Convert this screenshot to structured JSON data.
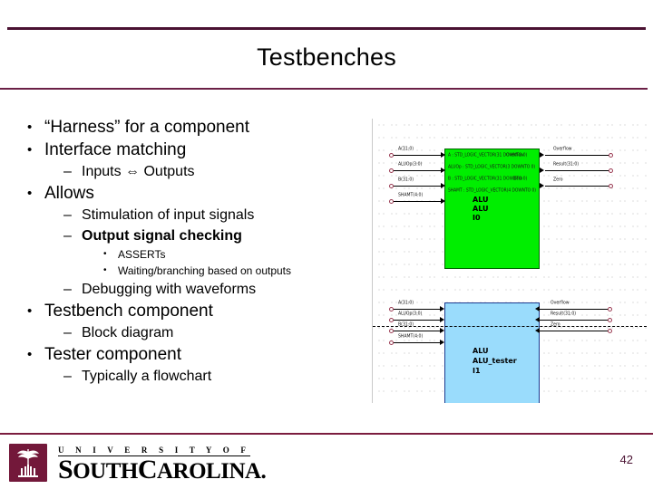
{
  "slide": {
    "title": "Testbenches",
    "page_number": "42",
    "accent_color": "#4a1232",
    "rule_color": "#6b2046"
  },
  "bullets": [
    {
      "level": 1,
      "marker": "•",
      "text": "“Harness” for a component",
      "bold": false
    },
    {
      "level": 1,
      "marker": "•",
      "text": "Interface matching",
      "bold": false
    },
    {
      "level": 2,
      "marker": "–",
      "text": "Inputs ⇔ Outputs",
      "bold": false
    },
    {
      "level": 1,
      "marker": "•",
      "text": "Allows",
      "bold": false
    },
    {
      "level": 2,
      "marker": "–",
      "text": "Stimulation of input signals",
      "bold": false
    },
    {
      "level": 2,
      "marker": "–",
      "text": "Output signal checking",
      "bold": true
    },
    {
      "level": 3,
      "marker": "•",
      "text": "ASSERTs",
      "bold": false
    },
    {
      "level": 3,
      "marker": "•",
      "text": "Waiting/branching based on outputs",
      "bold": false
    },
    {
      "level": 2,
      "marker": "–",
      "text": "Debugging with waveforms",
      "bold": false
    },
    {
      "level": 1,
      "marker": "•",
      "text": "Testbench component",
      "bold": false
    },
    {
      "level": 2,
      "marker": "–",
      "text": "Block diagram",
      "bold": false
    },
    {
      "level": 1,
      "marker": "•",
      "text": "Tester component",
      "bold": false
    },
    {
      "level": 2,
      "marker": "–",
      "text": "Typically a flowchart",
      "bold": false
    }
  ],
  "schematic": {
    "green_block": {
      "fill_color": "#00ee00",
      "label_lines": [
        "ALU",
        "ALU",
        "I0"
      ],
      "port_text_lines": [
        "A : STD_LOGIC_VECTOR(31 DOWNTO 0)",
        "ALUOp : STD_LOGIC_VECTOR(3 DOWNTO 0)",
        "B : STD_LOGIC_VECTOR(31 DOWNTO 0)",
        "SHAMT : STD_LOGIC_VECTOR(4 DOWNTO 0)"
      ],
      "inner_right_lines": [
        "Overflow",
        "Result",
        "Zero"
      ],
      "inputs": [
        "A(31:0)",
        "ALUOp(3:0)",
        "B(31:0)",
        "SHAMT(4:0)"
      ],
      "outputs": [
        "Overflow",
        "Result(31:0)",
        "Zero"
      ]
    },
    "blue_block": {
      "fill_color": "#9adcfc",
      "label_lines": [
        "ALU",
        "ALU_tester",
        "I1"
      ],
      "inputs": [
        "A(31:0)",
        "ALUOp(3:0)",
        "B(31:0)",
        "SHAMT(4:0)"
      ],
      "outputs": [
        "Overflow",
        "Result(31:0)",
        "Zero"
      ]
    }
  },
  "footer": {
    "university_line": "U N I V E R S I T Y   O F",
    "name_prefix": "S",
    "name_rest": "OUTH",
    "name_c": "C",
    "name_tail": "AROLINA.",
    "logo_color": "#73183a"
  }
}
